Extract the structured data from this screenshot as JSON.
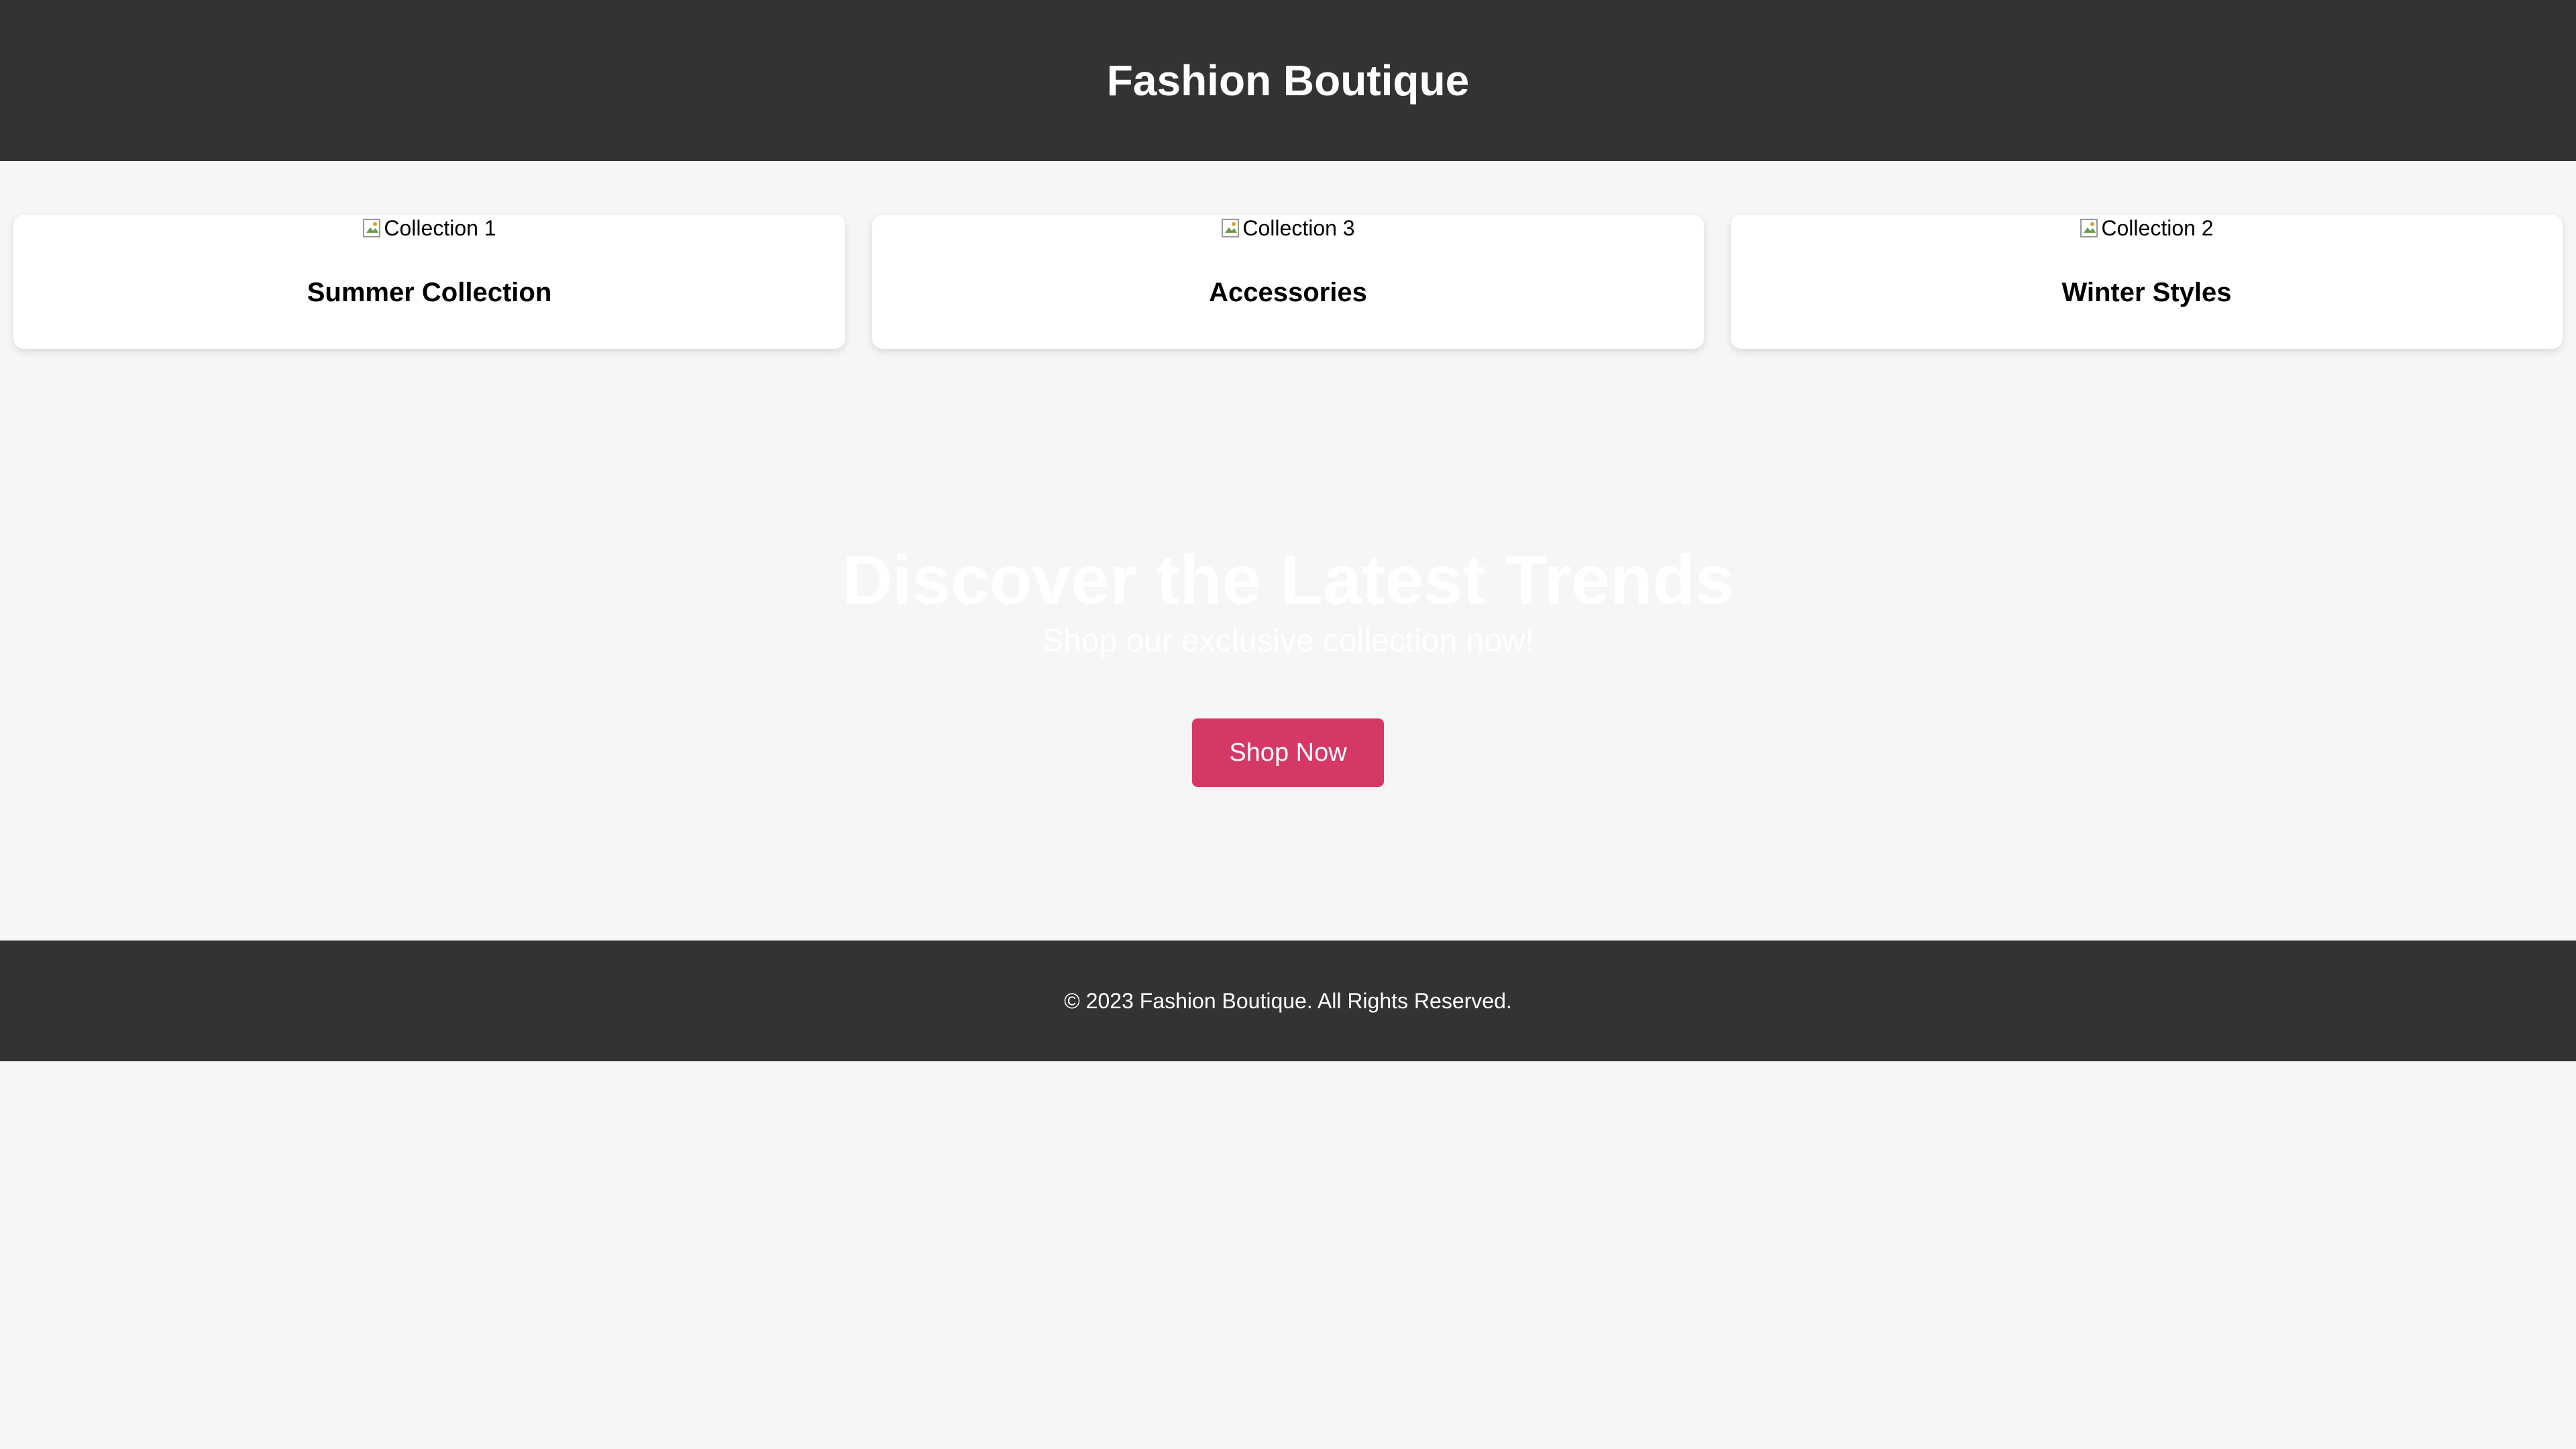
{
  "header": {
    "title": "Fashion Boutique"
  },
  "collections": [
    {
      "image_alt": "Collection 1",
      "title": "Summer Collection"
    },
    {
      "image_alt": "Collection 3",
      "title": "Accessories"
    },
    {
      "image_alt": "Collection 2",
      "title": "Winter Styles"
    }
  ],
  "hero": {
    "headline": "Discover the Latest Trends",
    "subtitle": "Shop our exclusive collection now!",
    "button_label": "Shop Now"
  },
  "footer": {
    "copyright": "© 2023 Fashion Boutique. All Rights Reserved."
  },
  "colors": {
    "header_bg": "#333333",
    "page_bg": "#f6f6f6",
    "accent": "#d63865"
  },
  "icons": {
    "broken_image": "broken-image-icon"
  }
}
